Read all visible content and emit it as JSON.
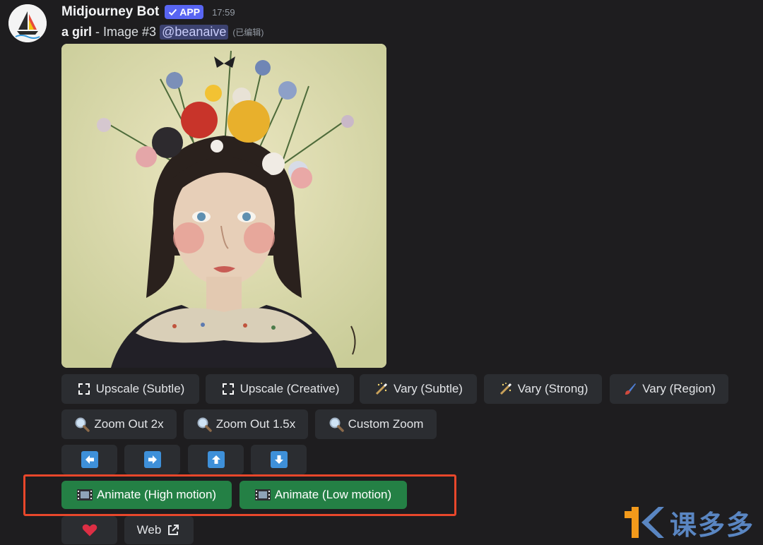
{
  "message": {
    "author": "Midjourney Bot",
    "badge_label": "APP",
    "timestamp": "17:59",
    "prompt": "a girl",
    "image_label": "- Image #3",
    "mention": "@beanaive",
    "edited": "(已编辑)"
  },
  "buttons": {
    "row1": [
      {
        "label": "Upscale (Subtle)",
        "icon": "expand-icon"
      },
      {
        "label": "Upscale (Creative)",
        "icon": "expand-icon"
      },
      {
        "label": "Vary (Subtle)",
        "icon": "magic-wand-icon"
      },
      {
        "label": "Vary (Strong)",
        "icon": "magic-wand-icon"
      },
      {
        "label": "Vary (Region)",
        "icon": "paintbrush-icon"
      }
    ],
    "row2": [
      {
        "label": "Zoom Out 2x",
        "icon": "magnifier-icon"
      },
      {
        "label": "Zoom Out 1.5x",
        "icon": "magnifier-icon"
      },
      {
        "label": "Custom Zoom",
        "icon": "magnifier-icon"
      }
    ],
    "row3": [
      {
        "icon": "arrow-left-icon"
      },
      {
        "icon": "arrow-right-icon"
      },
      {
        "icon": "arrow-up-icon"
      },
      {
        "icon": "arrow-down-icon"
      }
    ],
    "row4": [
      {
        "label": "Animate (High motion)",
        "icon": "film-icon"
      },
      {
        "label": "Animate (Low motion)",
        "icon": "film-icon"
      }
    ],
    "row5": [
      {
        "icon": "heart-icon"
      },
      {
        "label": "Web",
        "icon": "external-link-icon"
      }
    ]
  },
  "watermark": {
    "text": "课多多"
  },
  "colors": {
    "accent_green": "#248045",
    "highlight_border": "#e8472b",
    "mention_bg": "#3c4270",
    "badge_bg": "#5865f2"
  }
}
